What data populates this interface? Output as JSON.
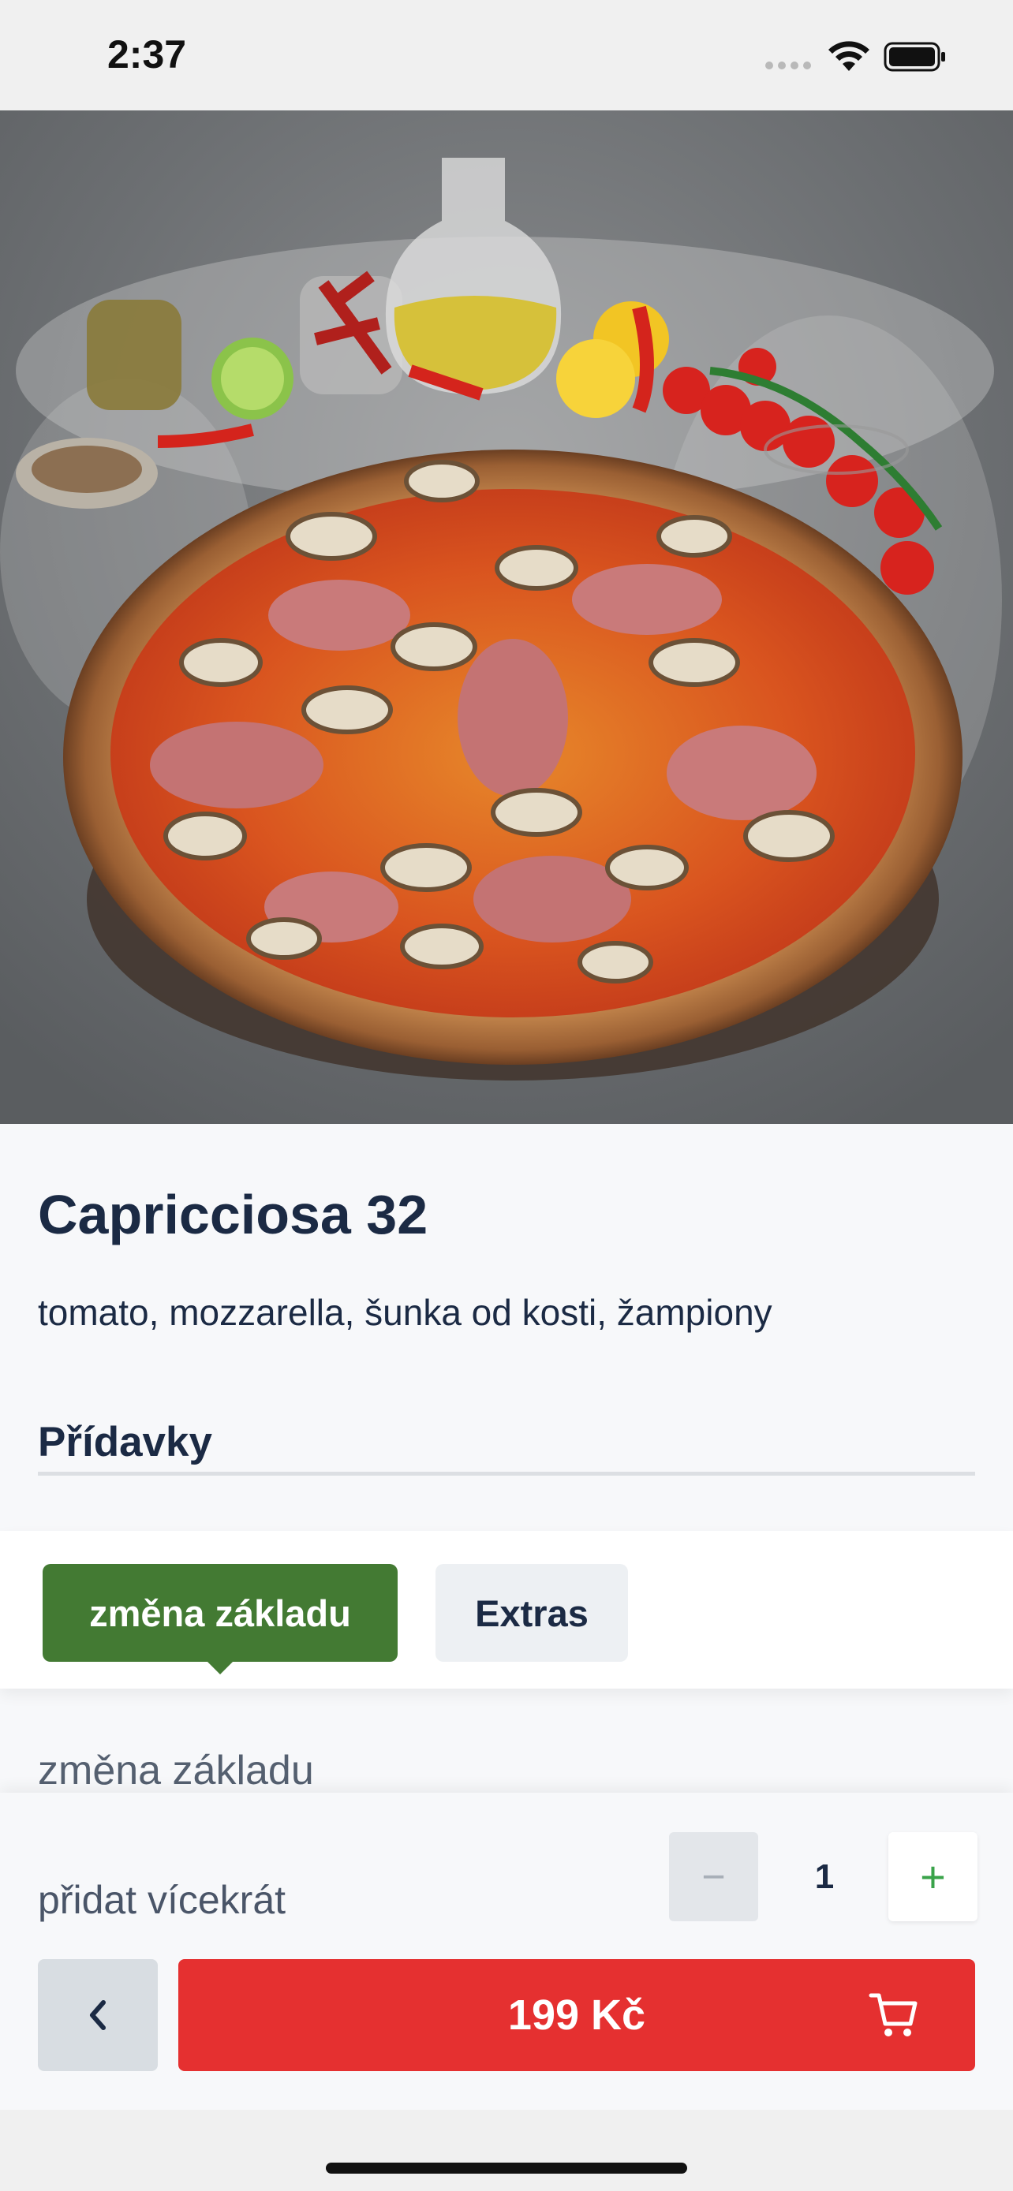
{
  "status_bar": {
    "time": "2:37"
  },
  "product": {
    "name": "Capricciosa 32",
    "description": "tomato, mozzarella, šunka od kosti, žampiony"
  },
  "addons": {
    "heading": "Přídavky",
    "tabs": [
      {
        "label": "změna základu",
        "active": true
      },
      {
        "label": "Extras",
        "active": false
      }
    ],
    "group_label": "změna základu"
  },
  "quantity": {
    "label": "přidat vícekrát",
    "value": "1",
    "minus": "−",
    "plus": "+"
  },
  "actions": {
    "price": "199 Kč"
  },
  "colors": {
    "accent_green": "#437a33",
    "cta_red": "#e53030",
    "text_dark": "#1b2a44"
  }
}
